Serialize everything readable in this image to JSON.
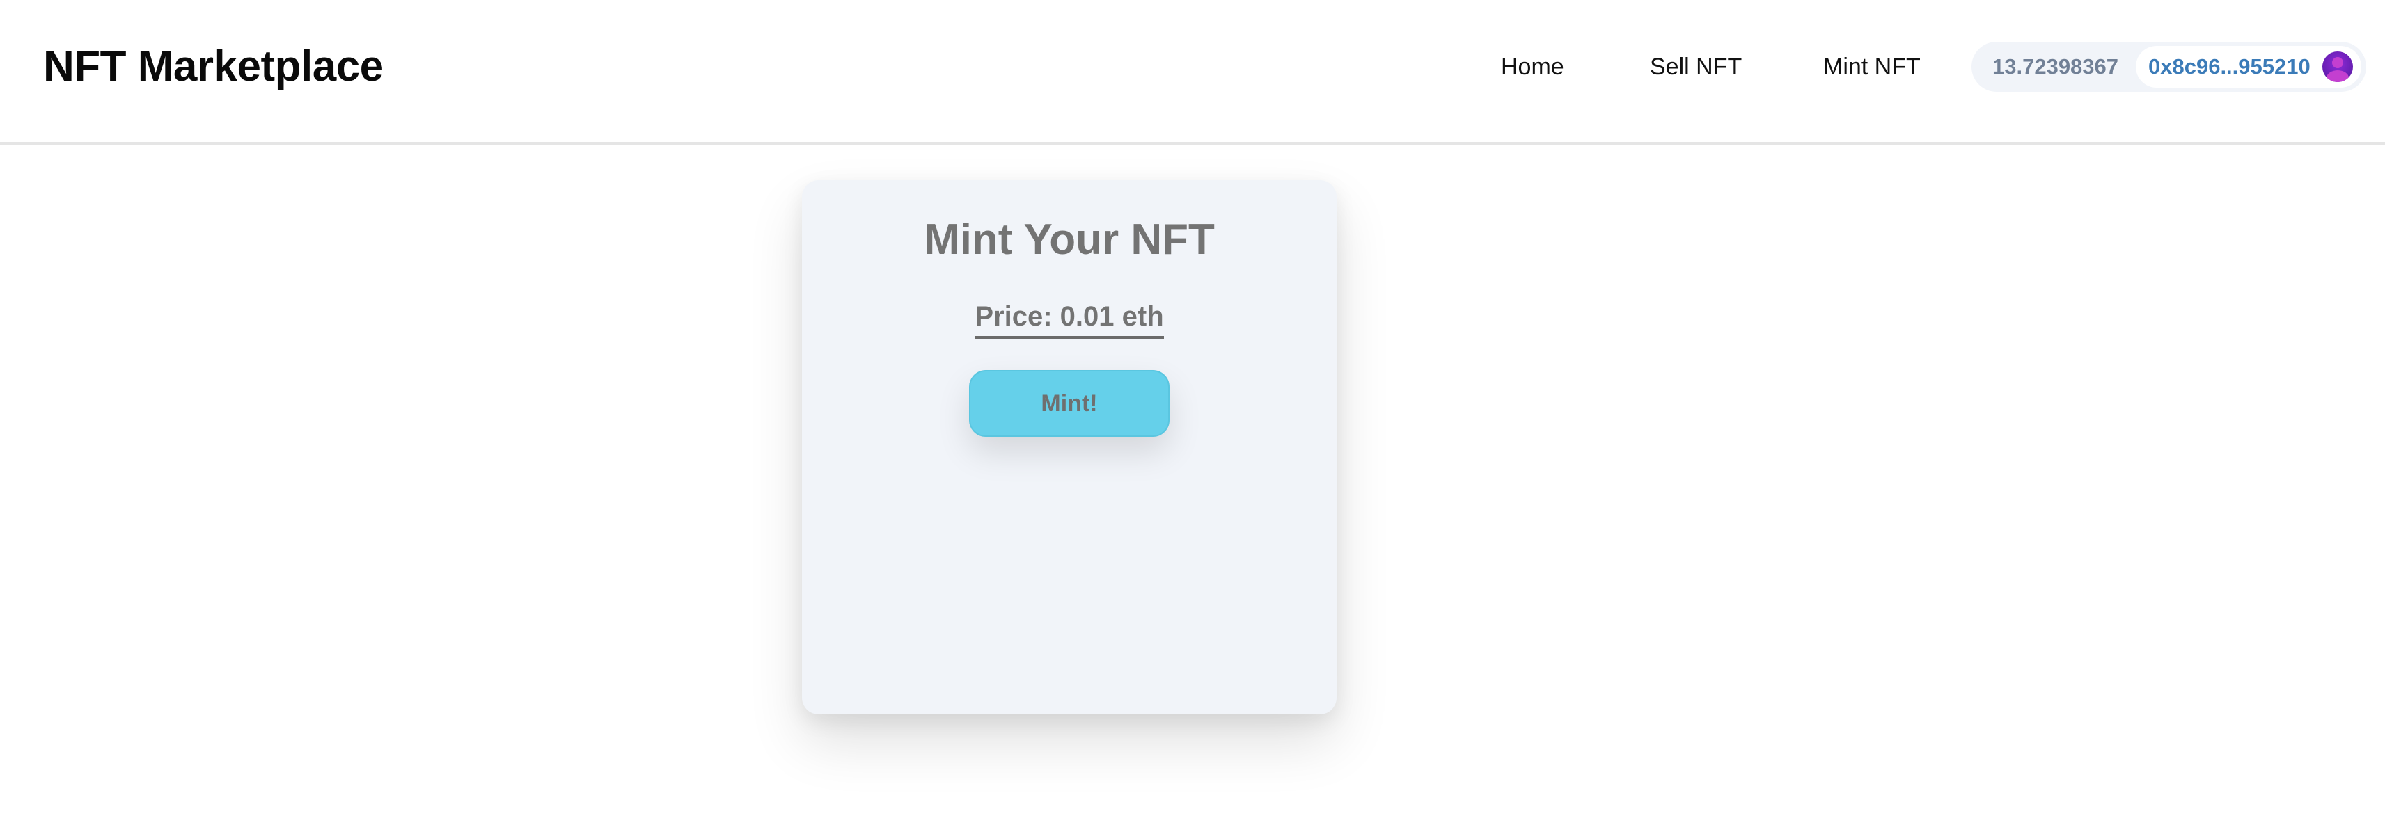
{
  "header": {
    "brand": "NFT Marketplace",
    "nav": {
      "home": "Home",
      "sell": "Sell NFT",
      "mint": "Mint NFT"
    },
    "wallet": {
      "balance": "13.72398367",
      "address": "0x8c96...955210",
      "avatar_icon": "purple-user-avatar-icon"
    }
  },
  "mint_card": {
    "title": "Mint Your NFT",
    "price": "Price: 0.01 eth",
    "button_label": "Mint!"
  },
  "colors": {
    "background": "#ffffff",
    "card_background": "#f1f4f9",
    "button": "#65d0ea",
    "address_text": "#3b7bb8",
    "balance_text": "#718096",
    "muted_text": "#737373"
  }
}
